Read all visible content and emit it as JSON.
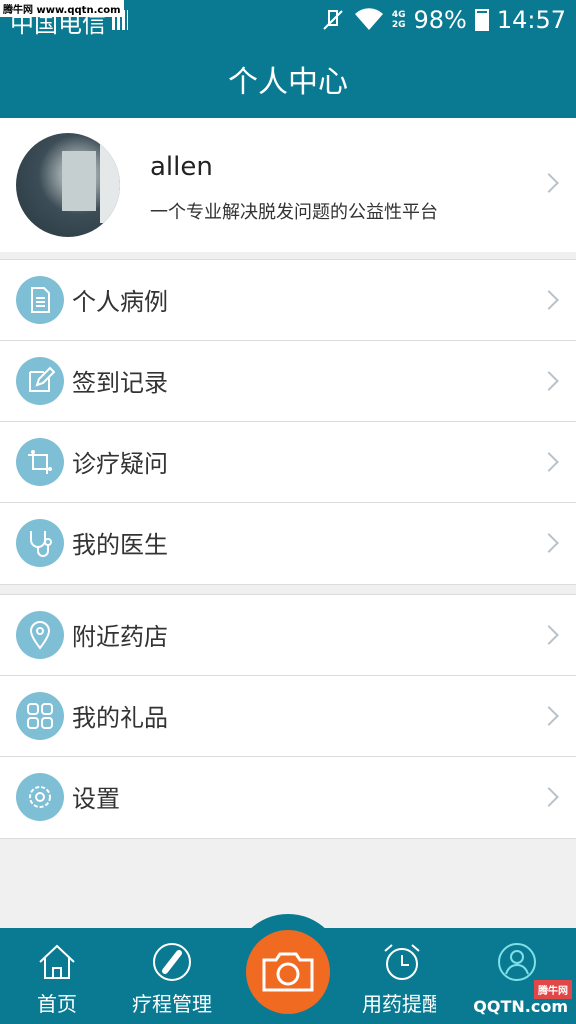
{
  "status": {
    "carrier": "中国电信",
    "network": [
      "4G",
      "2G"
    ],
    "battery": "98%",
    "time": "14:57"
  },
  "watermark_top": "腾牛网 www.qqtn.com",
  "title": "个人中心",
  "profile": {
    "name": "allen",
    "desc": "一个专业解决脱发问题的公益性平台"
  },
  "group1": [
    {
      "label": "个人病例",
      "icon": "document-icon"
    },
    {
      "label": "签到记录",
      "icon": "edit-icon"
    },
    {
      "label": "诊疗疑问",
      "icon": "crop-icon"
    },
    {
      "label": "我的医生",
      "icon": "stethoscope-icon"
    }
  ],
  "group2": [
    {
      "label": "附近药店",
      "icon": "location-icon"
    },
    {
      "label": "我的礼品",
      "icon": "grid-icon"
    },
    {
      "label": "设置",
      "icon": "gear-icon"
    }
  ],
  "tabs": {
    "home": "首页",
    "course": "疗程管理",
    "reminder": "用药提醒"
  },
  "brand": {
    "main": "QQTN.com",
    "badge": "腾牛网"
  },
  "colors": {
    "primary": "#0a7a92",
    "accent": "#f06a22",
    "icon_bg": "#7fbfd6"
  }
}
